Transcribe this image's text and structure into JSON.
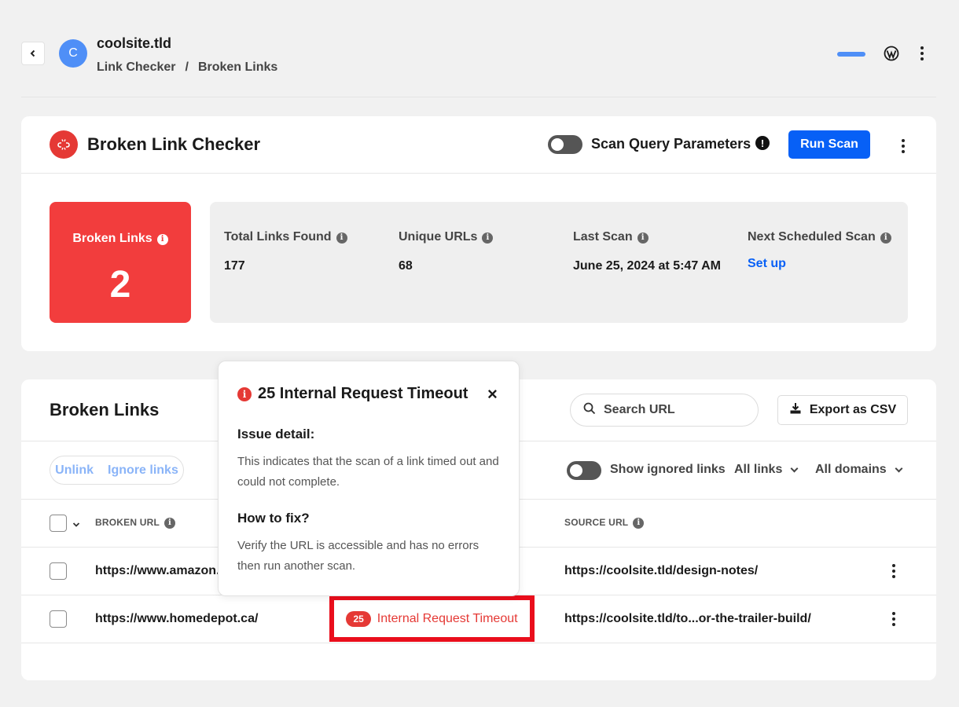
{
  "header": {
    "back_icon": "chevron-left-icon",
    "avatar_letter": "C",
    "site_name": "coolsite.tld",
    "breadcrumb": [
      "Link Checker",
      "/",
      "Broken Links"
    ],
    "accent": "#4f8ff7"
  },
  "checker": {
    "title": "Broken Link Checker",
    "toggle_label": "Scan Query Parameters",
    "toggle_on": false,
    "warn_glyph": "!",
    "run_label": "Run Scan",
    "brand_color": "#0760f6",
    "danger_color": "#f23d3d"
  },
  "summary": {
    "broken_label": "Broken Links",
    "broken_count": "2",
    "info_glyph": "i",
    "stats": [
      {
        "label": "Total Links Found",
        "value": "177"
      },
      {
        "label": "Unique URLs",
        "value": "68"
      },
      {
        "label": "Last Scan",
        "value": "June 25, 2024 at 5:47 AM"
      },
      {
        "label": "Next Scheduled Scan",
        "value": "Set up"
      }
    ]
  },
  "links": {
    "title": "Broken Links",
    "search_placeholder": "Search URL",
    "export_label": "Export as CSV",
    "bulk": {
      "unlink": "Unlink",
      "ignore": "Ignore links"
    },
    "show_ignored_label": "Show ignored links",
    "filter_links": "All links",
    "filter_domains": "All domains",
    "columns": {
      "broken_url": "BROKEN URL",
      "source_url": "SOURCE URL"
    },
    "rows": [
      {
        "broken_url": "https://www.amazon.c",
        "source_url": "https://coolsite.tld/design-notes/"
      },
      {
        "broken_url": "https://www.homedepot.ca/",
        "status_code": "25",
        "status_text": "Internal Request Timeout",
        "source_url": "https://coolsite.tld/to...or-the-trailer-build/"
      }
    ]
  },
  "popover": {
    "glyph": "i",
    "title": "25 Internal Request Timeout",
    "close": "×",
    "issue_heading": "Issue detail:",
    "issue_text": "This indicates that the scan of a link timed out and could not complete.",
    "fix_heading": "How to fix?",
    "fix_text": "Verify the URL is accessible and has no errors then run another scan."
  }
}
